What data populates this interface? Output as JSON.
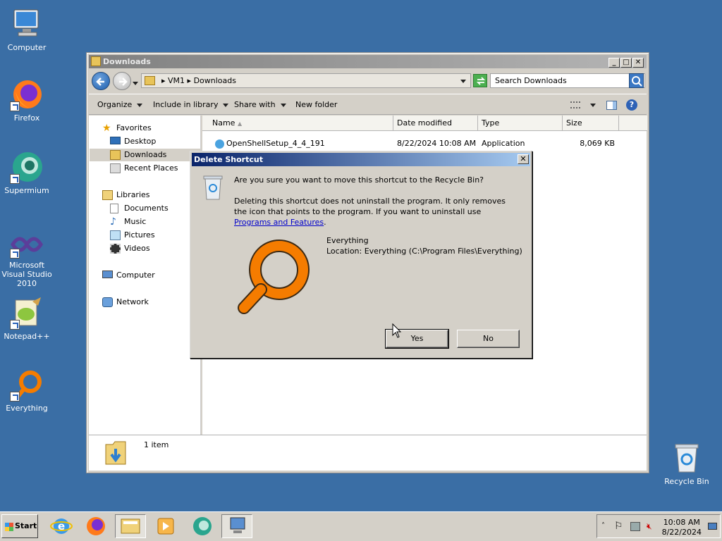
{
  "desktop": {
    "icons": [
      {
        "label": "Computer",
        "icon": "computer-icon"
      },
      {
        "label": "Firefox",
        "icon": "firefox-icon"
      },
      {
        "label": "Supermium",
        "icon": "supermium-icon"
      },
      {
        "label": "Microsoft Visual Studio 2010",
        "icon": "visual-studio-icon"
      },
      {
        "label": "Notepad++",
        "icon": "notepadpp-icon"
      },
      {
        "label": "Everything",
        "icon": "everything-icon"
      },
      {
        "label": "Recycle Bin",
        "icon": "recycle-bin-icon"
      }
    ]
  },
  "explorer": {
    "title": "Downloads",
    "address": {
      "root": "VM1",
      "folder": "Downloads"
    },
    "search_placeholder": "Search Downloads",
    "toolbar": {
      "organize": "Organize",
      "include": "Include in library",
      "share": "Share with",
      "new_folder": "New folder"
    },
    "nav": {
      "favorites": "Favorites",
      "desktop": "Desktop",
      "downloads": "Downloads",
      "recent": "Recent Places",
      "libraries": "Libraries",
      "documents": "Documents",
      "music": "Music",
      "pictures": "Pictures",
      "videos": "Videos",
      "computer": "Computer",
      "network": "Network"
    },
    "columns": {
      "name": "Name",
      "date": "Date modified",
      "type": "Type",
      "size": "Size"
    },
    "files": [
      {
        "name": "OpenShellSetup_4_4_191",
        "date": "8/22/2024 10:08 AM",
        "type": "Application",
        "size": "8,069 KB"
      }
    ],
    "status": "1 item"
  },
  "dialog": {
    "title": "Delete Shortcut",
    "question": "Are you sure you want to move this shortcut to the Recycle Bin?",
    "info": "Deleting this shortcut does not uninstall the program. It only removes the icon that points to the program. If you want to uninstall use ",
    "link": "Programs and Features",
    "info_end": ".",
    "item_name": "Everything",
    "item_location": "Location: Everything (C:\\Program Files\\Everything)",
    "yes": "Yes",
    "no": "No"
  },
  "taskbar": {
    "start": "Start",
    "time": "10:08 AM",
    "date": "8/22/2024"
  },
  "colors": {
    "desktop": "#3a6ea5",
    "dialog_title": "#0a246a",
    "everything_orange": "#f57c00"
  }
}
